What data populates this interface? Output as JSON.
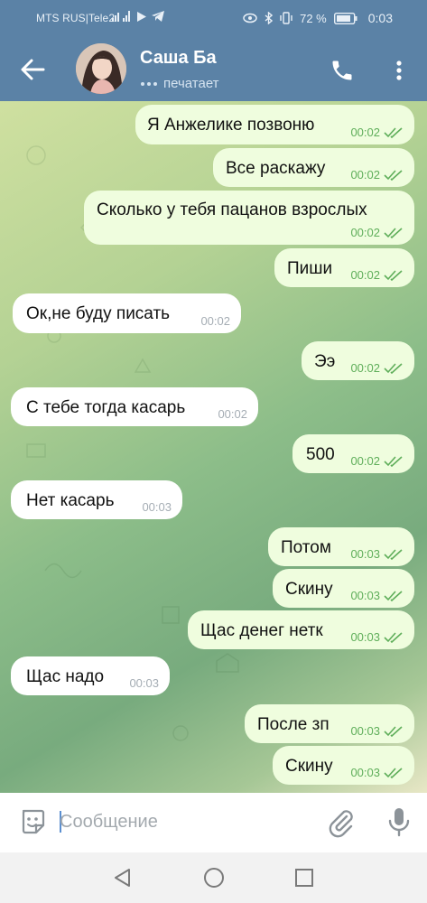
{
  "status_bar": {
    "carrier": "MTS RUS|Tele2",
    "battery_percent": "72 %",
    "time": "0:03"
  },
  "header": {
    "title": "Саша Ба",
    "subtitle": "печатает"
  },
  "messages": [
    {
      "dir": "out",
      "text": "Я Анжелике позвоню",
      "time": "00:02"
    },
    {
      "dir": "out",
      "text": "Все раскажу",
      "time": "00:02"
    },
    {
      "dir": "out",
      "text": "Сколько у тебя пацанов взрослых",
      "time": "00:02"
    },
    {
      "dir": "out",
      "text": "Пиши",
      "time": "00:02"
    },
    {
      "dir": "in",
      "text": "Ок,не буду писать",
      "time": "00:02"
    },
    {
      "dir": "out",
      "text": "Ээ",
      "time": "00:02"
    },
    {
      "dir": "in",
      "text": "С тебе тогда касарь",
      "time": "00:02"
    },
    {
      "dir": "out",
      "text": "500",
      "time": "00:02"
    },
    {
      "dir": "in",
      "text": "Нет касарь",
      "time": "00:03"
    },
    {
      "dir": "out",
      "text": "Потом",
      "time": "00:03"
    },
    {
      "dir": "out",
      "text": "Скину",
      "time": "00:03"
    },
    {
      "dir": "out",
      "text": "Щас денег нетк",
      "time": "00:03"
    },
    {
      "dir": "in",
      "text": "Щас надо",
      "time": "00:03"
    },
    {
      "dir": "out",
      "text": "После зп",
      "time": "00:03"
    },
    {
      "dir": "out",
      "text": "Скину",
      "time": "00:03"
    }
  ],
  "composer": {
    "placeholder": "Сообщение"
  },
  "icons": {
    "back": "arrow-left-icon",
    "call": "phone-icon",
    "menu": "more-vertical-icon",
    "emoji": "sticker-icon",
    "attach": "paperclip-icon",
    "mic": "microphone-icon"
  },
  "colors": {
    "header": "#5b82a6",
    "outgoing_bubble": "#effdde",
    "incoming_bubble": "#ffffff",
    "read_ticks": "#5fae5a"
  }
}
